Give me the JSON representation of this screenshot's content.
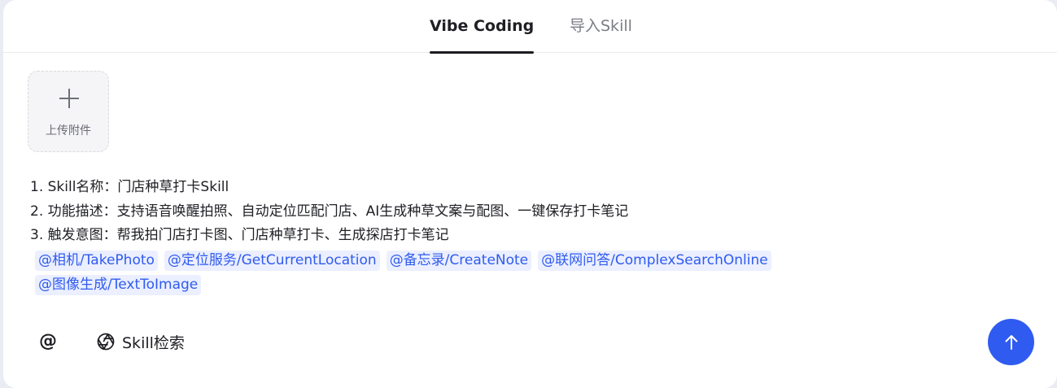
{
  "tabs": [
    {
      "label": "Vibe Coding",
      "active": true
    },
    {
      "label": "导入Skill",
      "active": false
    }
  ],
  "upload": {
    "label": "上传附件",
    "icon": "plus-icon"
  },
  "prompt": {
    "lines": [
      "1. Skill名称：门店种草打卡Skill",
      "2. 功能描述：支持语音唤醒拍照、自动定位匹配门店、AI生成种草文案与配图、一键保存打卡笔记",
      "3. 触发意图：帮我拍门店打卡图、门店种草打卡、生成探店打卡笔记"
    ],
    "mentions": [
      "@相机/TakePhoto",
      "@定位服务/GetCurrentLocation",
      "@备忘录/CreateNote",
      "@联网问答/ComplexSearchOnline",
      "@图像生成/TextToImage"
    ]
  },
  "toolbar": {
    "at_label": "@",
    "skill_search_label": "Skill检索",
    "skill_search_icon": "aperture-icon",
    "send_icon": "arrow-up-icon"
  },
  "colors": {
    "accent": "#2f5bf0",
    "mention_bg": "#ebefff",
    "text": "#202126",
    "muted": "#7b7d85"
  }
}
